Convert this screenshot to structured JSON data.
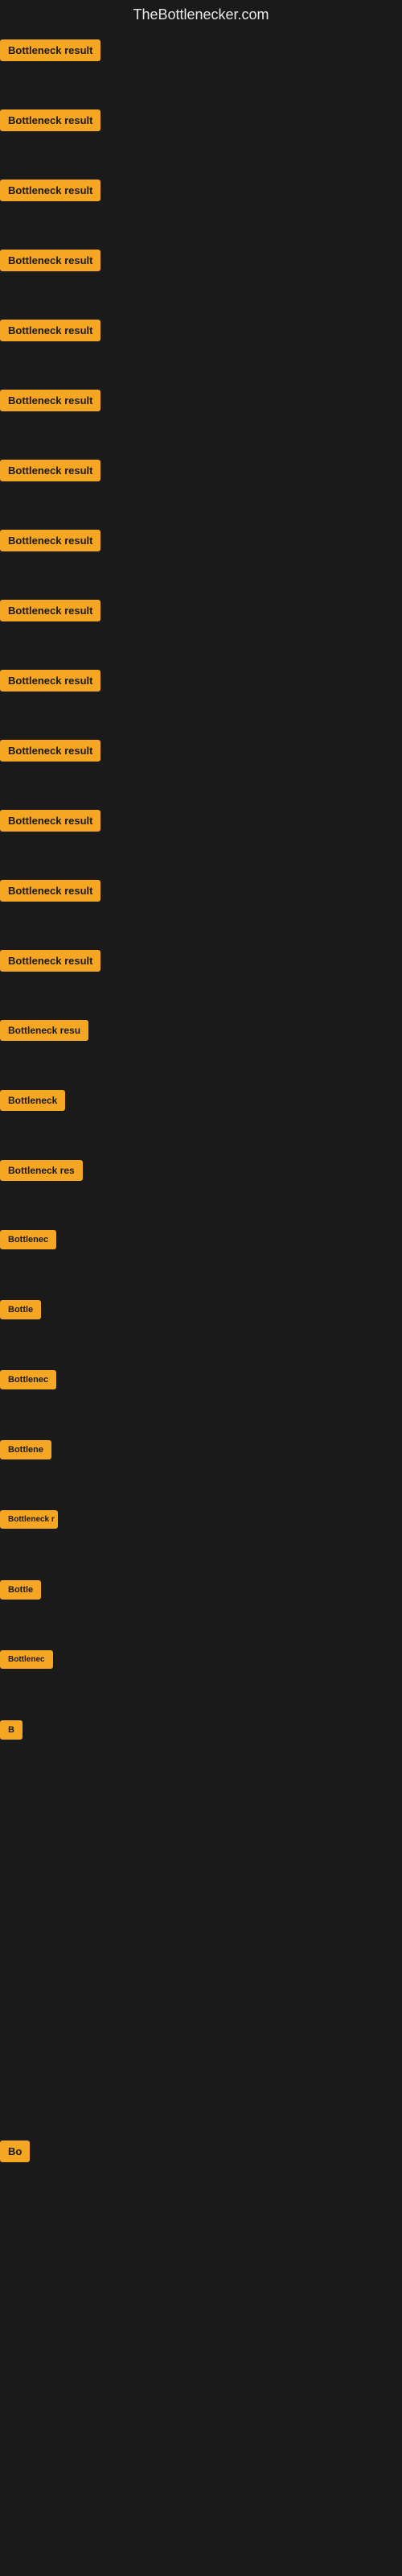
{
  "site": {
    "title": "TheBottlenecker.com"
  },
  "items": [
    {
      "id": 0,
      "label": "Bottleneck result",
      "visible": true
    },
    {
      "id": 1,
      "label": "Bottleneck result",
      "visible": true
    },
    {
      "id": 2,
      "label": "Bottleneck result",
      "visible": true
    },
    {
      "id": 3,
      "label": "Bottleneck result",
      "visible": true
    },
    {
      "id": 4,
      "label": "Bottleneck result",
      "visible": true
    },
    {
      "id": 5,
      "label": "Bottleneck result",
      "visible": true
    },
    {
      "id": 6,
      "label": "Bottleneck result",
      "visible": true
    },
    {
      "id": 7,
      "label": "Bottleneck result",
      "visible": true
    },
    {
      "id": 8,
      "label": "Bottleneck result",
      "visible": true
    },
    {
      "id": 9,
      "label": "Bottleneck result",
      "visible": true
    },
    {
      "id": 10,
      "label": "Bottleneck result",
      "visible": true
    },
    {
      "id": 11,
      "label": "Bottleneck result",
      "visible": true
    },
    {
      "id": 12,
      "label": "Bottleneck result",
      "visible": true
    },
    {
      "id": 13,
      "label": "Bottleneck result",
      "visible": true
    },
    {
      "id": 14,
      "label": "Bottleneck resu",
      "visible": true
    },
    {
      "id": 15,
      "label": "Bottleneck",
      "visible": true
    },
    {
      "id": 16,
      "label": "Bottleneck res",
      "visible": true
    },
    {
      "id": 17,
      "label": "Bottlenec",
      "visible": true
    },
    {
      "id": 18,
      "label": "Bottle",
      "visible": true
    },
    {
      "id": 19,
      "label": "Bottlenec",
      "visible": true
    },
    {
      "id": 20,
      "label": "Bottlene",
      "visible": true
    },
    {
      "id": 21,
      "label": "Bottleneck r",
      "visible": true
    },
    {
      "id": 22,
      "label": "Bottle",
      "visible": true
    },
    {
      "id": 23,
      "label": "Bottlenec",
      "visible": true
    },
    {
      "id": 24,
      "label": "B",
      "visible": true
    },
    {
      "id": 25,
      "label": "",
      "visible": false
    },
    {
      "id": 26,
      "label": "",
      "visible": false
    },
    {
      "id": 27,
      "label": "",
      "visible": false
    },
    {
      "id": 28,
      "label": "",
      "visible": false
    },
    {
      "id": 29,
      "label": "",
      "visible": false
    },
    {
      "id": 30,
      "label": "Bo",
      "visible": true
    },
    {
      "id": 31,
      "label": "",
      "visible": false
    },
    {
      "id": 32,
      "label": "",
      "visible": false
    },
    {
      "id": 33,
      "label": "",
      "visible": false
    },
    {
      "id": 34,
      "label": "",
      "visible": false
    },
    {
      "id": 35,
      "label": "",
      "visible": false
    }
  ],
  "colors": {
    "background": "#1a1a1a",
    "badge_bg": "#f5a623",
    "badge_text": "#1a1a1a",
    "site_title": "#e8e8e8"
  }
}
